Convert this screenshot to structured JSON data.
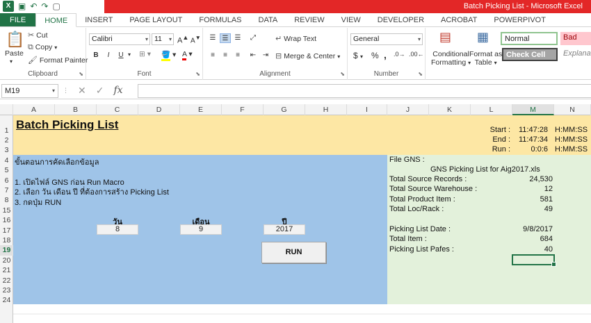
{
  "window": {
    "title": "Batch Picking List -  Microsoft Excel"
  },
  "tabs": [
    "FILE",
    "HOME",
    "INSERT",
    "PAGE LAYOUT",
    "FORMULAS",
    "DATA",
    "REVIEW",
    "VIEW",
    "DEVELOPER",
    "ACROBAT",
    "POWERPIVOT"
  ],
  "ribbon": {
    "clipboard": {
      "paste": "Paste",
      "cut": "Cut",
      "copy": "Copy",
      "format_painter": "Format Painter",
      "label": "Clipboard"
    },
    "font": {
      "name": "Calibri",
      "size": "11",
      "label": "Font",
      "bold": "B",
      "italic": "I",
      "underline": "U"
    },
    "alignment": {
      "wrap_text": "Wrap Text",
      "merge_center": "Merge & Center",
      "label": "Alignment"
    },
    "number": {
      "format": "General",
      "label": "Number",
      "currency": "$",
      "percent": "%",
      "comma": ","
    },
    "styles": {
      "conditional_1": "Conditional",
      "conditional_2": "Formatting",
      "format_table_1": "Format as",
      "format_table_2": "Table",
      "normal": "Normal",
      "bad": "Bad",
      "check_cell": "Check Cell",
      "explanatory": "Explanat"
    }
  },
  "formula_bar": {
    "name_box": "M19",
    "fx": "fx",
    "value": ""
  },
  "columns": [
    "A",
    "B",
    "C",
    "D",
    "E",
    "F",
    "G",
    "H",
    "I",
    "J",
    "K",
    "L",
    "M",
    "N"
  ],
  "selected_column": "M",
  "rows": [
    "1",
    "2",
    "3",
    "4",
    "5",
    "6",
    "7",
    "8",
    "15",
    "16",
    "17",
    "18",
    "19",
    "20",
    "21",
    "22",
    "23",
    "24"
  ],
  "selected_row": "19",
  "sheet": {
    "title": "Batch Picking List",
    "timing": {
      "start_label": "Start :",
      "start_value": "11:47:28",
      "start_fmt": "H:MM:SS",
      "end_label": "End :",
      "end_value": "11:47:34",
      "end_fmt": "H:MM:SS",
      "run_label": "Run :",
      "run_value": "0:0:6",
      "run_fmt": "H:MM:SS"
    },
    "steps_heading": "ขั้นตอนการคัดเลือกข้อมูล",
    "steps": [
      "1. เปิดไฟล์ GNS ก่อน Run Macro",
      "2. เลือก วัน เดือน ปี ที่ต้องการสร้าง Picking List",
      "3. กดปุ่ม RUN"
    ],
    "date_labels": {
      "day": "วัน",
      "month": "เดือน",
      "year": "ปี"
    },
    "date_values": {
      "day": "8",
      "month": "9",
      "year": "2017"
    },
    "run_button": "RUN",
    "info": {
      "file_label": "File GNS :",
      "file_name": "GNS Picking List for Aig2017.xls",
      "items": [
        {
          "label": "Total Source Records :",
          "value": "24,530"
        },
        {
          "label": "Total Source Warehouse :",
          "value": "12"
        },
        {
          "label": "Total Product Item :",
          "value": "581"
        },
        {
          "label": "Total Loc/Rack :",
          "value": "49"
        }
      ],
      "items2": [
        {
          "label": "Picking List Date :",
          "value": "9/8/2017"
        },
        {
          "label": "Total Item :",
          "value": "684"
        },
        {
          "label": "Picking List Pafes :",
          "value": "40"
        }
      ]
    }
  }
}
